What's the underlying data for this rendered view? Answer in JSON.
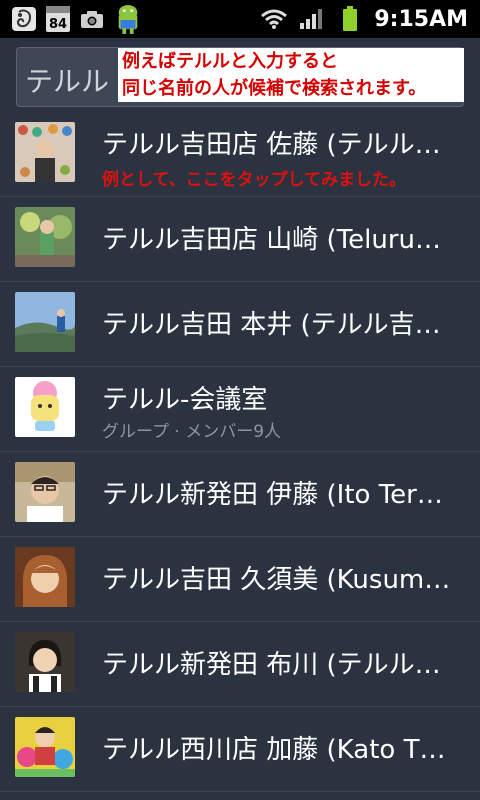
{
  "status_bar": {
    "calendar_day": "84",
    "time": "9:15AM",
    "icons": [
      "evernote-icon",
      "calendar-icon",
      "camera-icon",
      "android-icon",
      "wifi-icon",
      "signal-icon",
      "battery-icon"
    ]
  },
  "search": {
    "value": "テルル",
    "annotation_line1": "例えばテルルと入力すると",
    "annotation_line2": "同じ名前の人が候補で検索されます。"
  },
  "contacts": [
    {
      "name": "テルル吉田店 佐藤 (テルル…",
      "note": "例として、ここをタップしてみました。"
    },
    {
      "name": "テルル吉田店 山崎 (Teluru…"
    },
    {
      "name": "テルル吉田 本井 (テルル吉…"
    },
    {
      "name": "テルル-会議室",
      "sub": "グループ · メンバー9人"
    },
    {
      "name": "テルル新発田 伊藤 (Ito Ter…"
    },
    {
      "name": "テルル吉田 久須美 (Kusum…"
    },
    {
      "name": "テルル新発田 布川 (テルル…"
    },
    {
      "name": "テルル西川店 加藤 (Kato T…"
    }
  ],
  "colors": {
    "background": "#2b3240",
    "annotation_red": "#e01010",
    "status_bar": "#000000"
  }
}
